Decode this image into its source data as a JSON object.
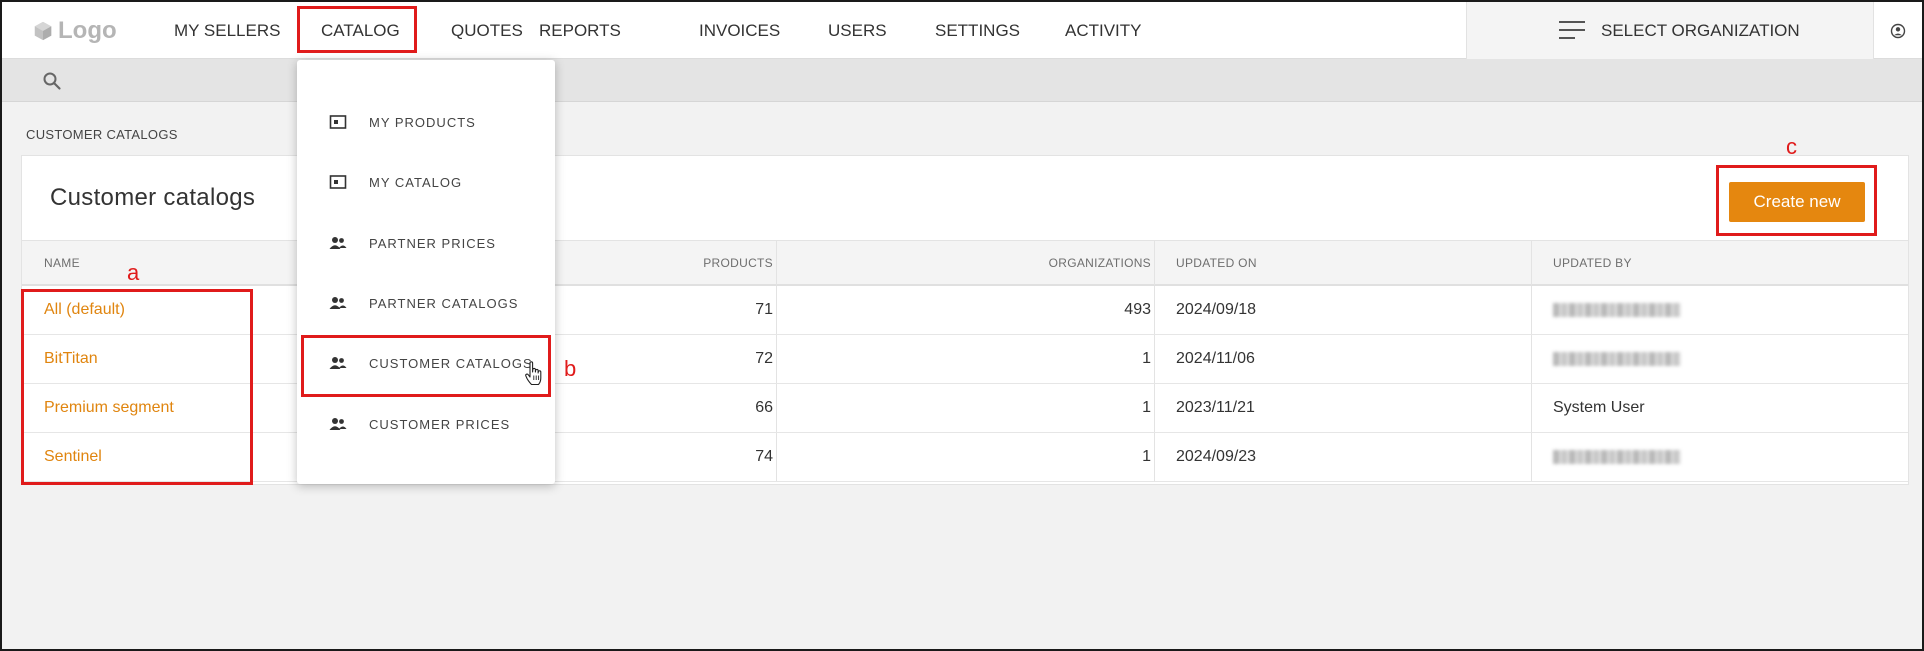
{
  "app": {
    "logo_text": "Logo"
  },
  "nav": {
    "items": [
      "MY SELLERS",
      "CATALOG",
      "QUOTES",
      "REPORTS",
      "INVOICES",
      "USERS",
      "SETTINGS",
      "ACTIVITY"
    ],
    "org_select_label": "SELECT ORGANIZATION"
  },
  "breadcrumb": "CUSTOMER CATALOGS",
  "page": {
    "title": "Customer catalogs",
    "create_button": "Create new"
  },
  "table": {
    "columns": [
      "NAME",
      "PRODUCTS",
      "ORGANIZATIONS",
      "UPDATED ON",
      "UPDATED BY"
    ],
    "rows": [
      {
        "name": "All (default)",
        "products": "71",
        "organizations": "493",
        "updated_on": "2024/09/18",
        "updated_by": ""
      },
      {
        "name": "BitTitan",
        "products": "72",
        "organizations": "1",
        "updated_on": "2024/11/06",
        "updated_by": ""
      },
      {
        "name": "Premium segment",
        "products": "66",
        "organizations": "1",
        "updated_on": "2023/11/21",
        "updated_by": "System User"
      },
      {
        "name": "Sentinel",
        "products": "74",
        "organizations": "1",
        "updated_on": "2024/09/23",
        "updated_by": ""
      }
    ]
  },
  "catalog_menu": {
    "items": [
      {
        "label": "MY PRODUCTS",
        "icon": "product-icon"
      },
      {
        "label": "MY CATALOG",
        "icon": "product-icon"
      },
      {
        "label": "PARTNER PRICES",
        "icon": "users-icon"
      },
      {
        "label": "PARTNER CATALOGS",
        "icon": "users-icon"
      },
      {
        "label": "CUSTOMER CATALOGS",
        "icon": "users-icon"
      },
      {
        "label": "CUSTOMER PRICES",
        "icon": "users-icon"
      }
    ]
  },
  "annotations": {
    "a": "a",
    "b": "b",
    "c": "c"
  },
  "colors": {
    "accent": "#e5870f",
    "link": "#e0850f",
    "annotation": "#e01b1b"
  }
}
